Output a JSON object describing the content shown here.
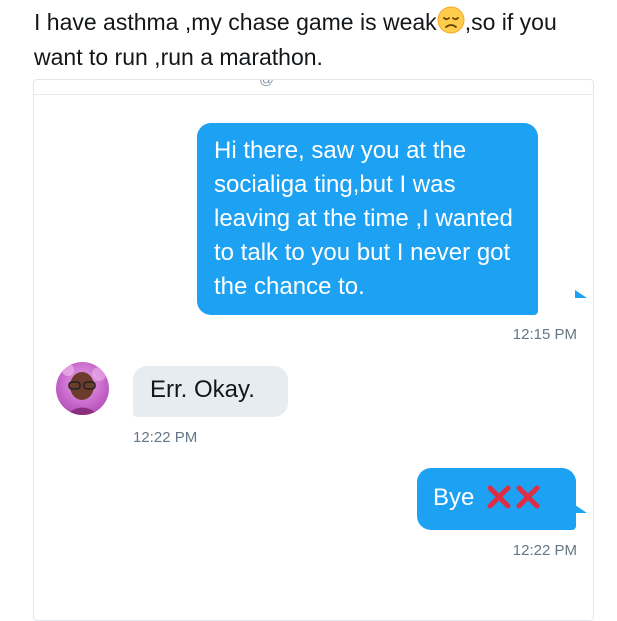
{
  "tweet": {
    "text_before_emoji": "I have asthma ,my chase game is weak",
    "emoji": "disappointed-face-emoji",
    "text_after_emoji": ",so if you want to run ,run a marathon."
  },
  "conversation": {
    "messages": [
      {
        "direction": "outgoing",
        "text": "Hi there, saw you at the socialiga ting,but I was leaving at the time ,I wanted to talk to you but I never got the chance to.",
        "time": "12:15 PM"
      },
      {
        "direction": "incoming",
        "text": "Err. Okay.",
        "time": "12:22 PM"
      },
      {
        "direction": "outgoing",
        "text": "Bye",
        "emoji": "cross-mark-emoji",
        "time": "12:22 PM"
      }
    ]
  },
  "colors": {
    "outgoing_bubble": "#1da1f2",
    "incoming_bubble": "#e6ecf0",
    "timestamp": "#657786",
    "cross_mark": "#dd2e44"
  }
}
